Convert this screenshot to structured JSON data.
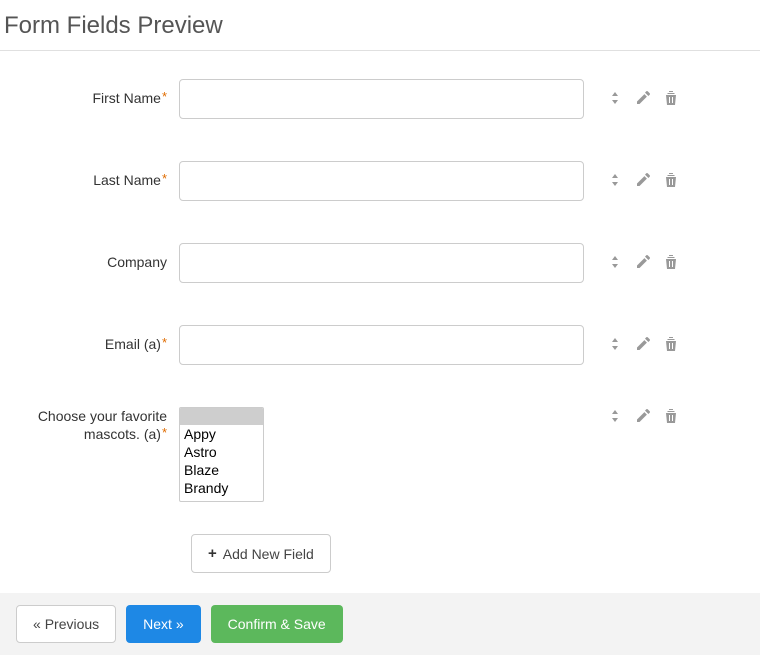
{
  "title": "Form Fields Preview",
  "fields": [
    {
      "label": "First Name",
      "required": true,
      "type": "text"
    },
    {
      "label": "Last Name",
      "required": true,
      "type": "text"
    },
    {
      "label": "Company",
      "required": false,
      "type": "text"
    },
    {
      "label": "Email (a)",
      "required": true,
      "type": "text"
    },
    {
      "label": "Choose your favorite mascots. (a)",
      "required": true,
      "type": "list",
      "options": [
        "",
        "Appy",
        "Astro",
        "Blaze",
        "Brandy"
      ]
    }
  ],
  "add_button_label": "Add New Field",
  "footer": {
    "previous": "Previous",
    "next": "Next",
    "confirm": "Confirm & Save"
  }
}
